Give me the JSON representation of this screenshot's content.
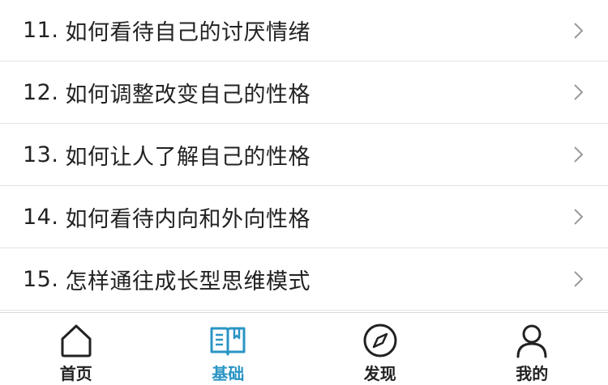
{
  "list": {
    "items": [
      {
        "num": "11.",
        "text": "如何看待自己的讨厌情绪"
      },
      {
        "num": "12.",
        "text": "如何调整改变自己的性格"
      },
      {
        "num": "13.",
        "text": "如何让人了解自己的性格"
      },
      {
        "num": "14.",
        "text": "如何看待内向和外向性格"
      },
      {
        "num": "15.",
        "text": "怎样通往成长型思维模式"
      }
    ],
    "chevron_icon": "chevron-right-icon"
  },
  "tabbar": {
    "tabs": [
      {
        "label": "首页",
        "icon": "home-icon",
        "active": false
      },
      {
        "label": "基础",
        "icon": "book-icon",
        "active": true
      },
      {
        "label": "发现",
        "icon": "compass-icon",
        "active": false
      },
      {
        "label": "我的",
        "icon": "user-icon",
        "active": false
      }
    ],
    "active_color": "#2a95c4",
    "inactive_color": "#222222"
  }
}
